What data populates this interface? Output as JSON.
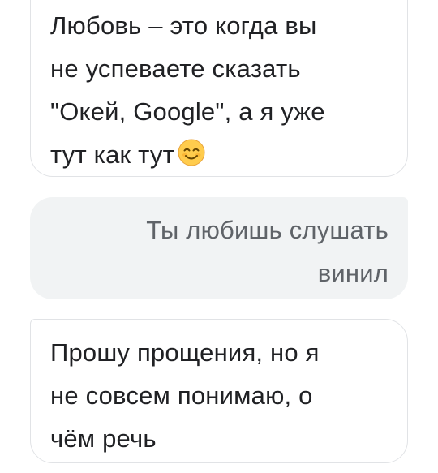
{
  "messages": [
    {
      "role": "assistant",
      "lines": [
        "Любовь – это когда вы",
        "не успеваете сказать",
        "\"Окей, Google\", а я уже",
        "тут как тут"
      ],
      "emoji": "smiling-face-with-smiling-eyes-icon"
    },
    {
      "role": "user",
      "lines": [
        "Ты любишь слушать",
        "винил"
      ]
    },
    {
      "role": "assistant",
      "lines": [
        "Прошу прощения, но я",
        "не совсем понимаю, о",
        "чём речь"
      ]
    }
  ],
  "colors": {
    "assistant_bubble_bg": "#ffffff",
    "assistant_bubble_border": "#e1e3e6",
    "assistant_text": "#202124",
    "user_bubble_bg": "#f1f3f4",
    "user_text": "#5f6368",
    "emoji_face": "#ffcc4d"
  }
}
